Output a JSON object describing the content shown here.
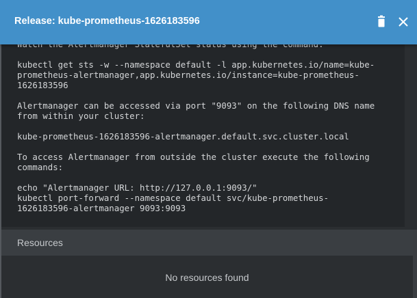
{
  "dialog": {
    "title": "Release: kube-prometheus-1626183596",
    "delete_icon": "trash-icon",
    "close_icon": "close-icon"
  },
  "notes": {
    "text": "Watch the Alertmanager StatefulSet status using the command:\n\nkubectl get sts -w --namespace default -l app.kubernetes.io/name=kube-\nprometheus-alertmanager,app.kubernetes.io/instance=kube-prometheus-\n1626183596\n\nAlertmanager can be accessed via port \"9093\" on the following DNS name\nfrom within your cluster:\n\nkube-prometheus-1626183596-alertmanager.default.svc.cluster.local\n\nTo access Alertmanager from outside the cluster execute the following\ncommands:\n\necho \"Alertmanager URL: http://127.0.0.1:9093/\"\nkubectl port-forward --namespace default svc/kube-prometheus-\n1626183596-alertmanager 9093:9093"
  },
  "resources": {
    "title": "Resources",
    "empty_message": "No resources found"
  },
  "colors": {
    "header": "#4290c9",
    "notes_background": "#232629",
    "panel_background": "#2b2e31",
    "section_header": "#3a3e42"
  }
}
